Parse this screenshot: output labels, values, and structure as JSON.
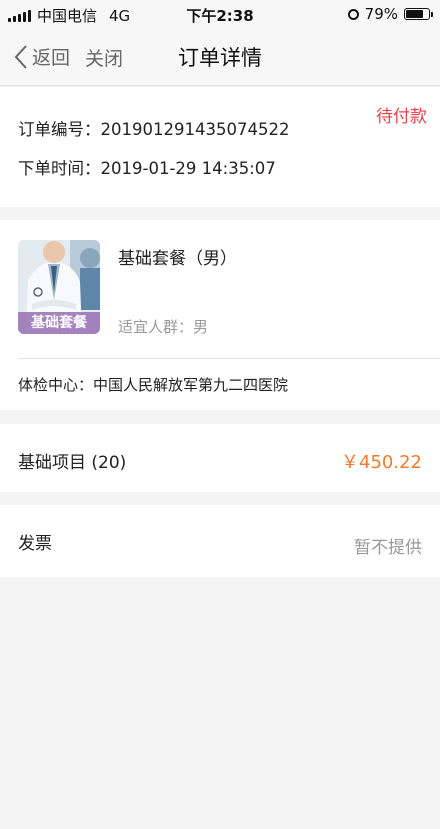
{
  "status_bar": {
    "carrier": "中国电信",
    "network": "4G",
    "time": "下午2:38",
    "battery": "79%",
    "battery_level": 0.79
  },
  "nav": {
    "back_label": "返回",
    "close_label": "关闭",
    "title": "订单详情"
  },
  "order": {
    "status": "待付款",
    "number_line": "订单编号：201901291435074522",
    "time_line": "下单时间：2019-01-29 14:35:07"
  },
  "package": {
    "image_caption": "基础套餐",
    "name": "基础套餐（男）",
    "target": "适宜人群：男",
    "center": "体检中心：中国人民解放军第九二四医院"
  },
  "items": {
    "label": "基础项目 (20)",
    "price": "￥450.22"
  },
  "invoice": {
    "label": "发票",
    "value": "暂不提供"
  },
  "colors": {
    "status_red": "#e8414a",
    "price_orange": "#ef7a2f",
    "caption_purple": "#966eb4"
  }
}
